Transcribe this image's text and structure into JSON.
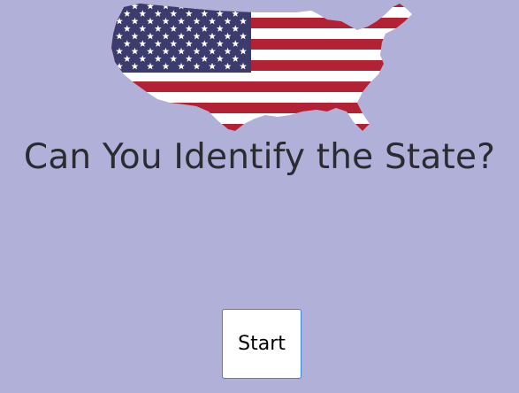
{
  "colors": {
    "background": "#b0b0d8",
    "title_text": "#2b2b31",
    "flag_blue": "#3c3b6e",
    "flag_red": "#b22234",
    "flag_white": "#ffffff",
    "button_border": "#3d86e0"
  },
  "logo": {
    "icon": "us-map-flag-icon"
  },
  "header": {
    "title": "Can You Identify the State?"
  },
  "main": {
    "start_label": "Start"
  }
}
